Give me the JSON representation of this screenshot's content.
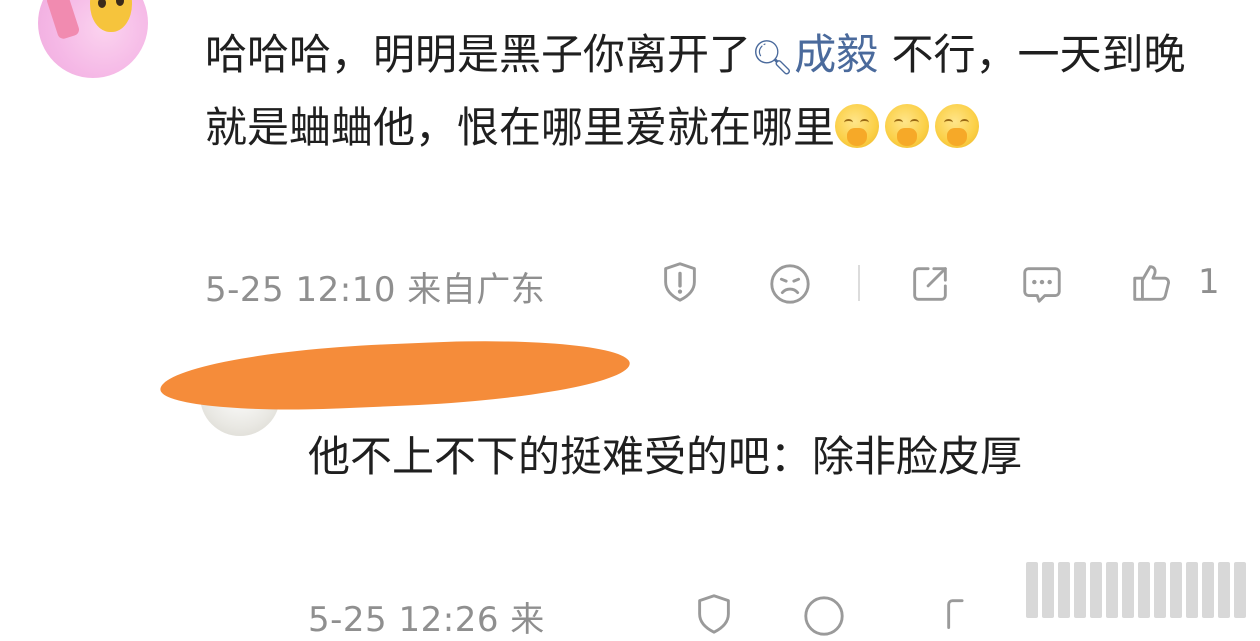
{
  "comment1": {
    "text_before": "哈哈哈，明明是黑子你离开了",
    "topic_icon": "search-icon",
    "topic": "成毅",
    "text_after": " 不行，一天到晚就是蛐蛐他，恨在哪里爱就在哪里",
    "emoji_name": "laugh-cover-mouth-emoji",
    "emoji_count": 3,
    "time": "5-25 12:10",
    "location": "来自广东",
    "actions": {
      "report_icon": "report-icon",
      "dislike_icon": "sad-face-icon",
      "share_icon": "share-icon",
      "reply_icon": "comment-icon",
      "like_icon": "thumbs-up-icon",
      "like_count": "1"
    }
  },
  "comment2": {
    "text": "他不上不下的挺难受的吧：除非脸皮厚",
    "time": "5-25 12:26",
    "location_partial": "来"
  },
  "colors": {
    "text": "#1f1f1f",
    "meta": "#8f8f8f",
    "link": "#4a6a9c",
    "redaction": "#f58c3a"
  }
}
